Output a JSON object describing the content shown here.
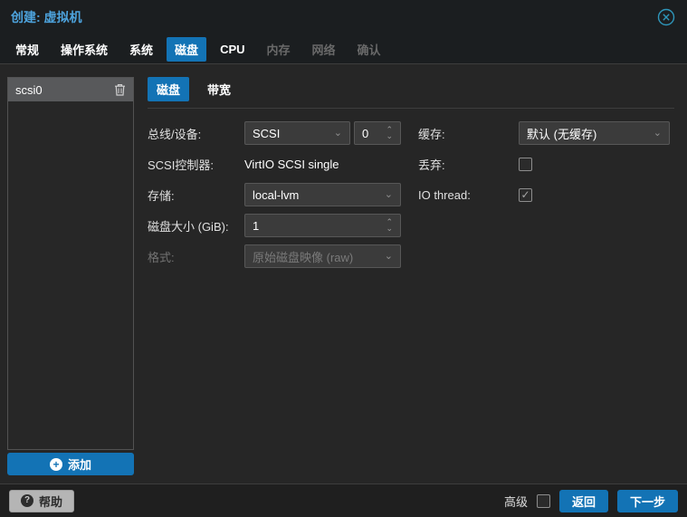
{
  "colors": {
    "accent": "#1373b5",
    "title_text": "#4da3dd",
    "close_icon": "#2e96ba"
  },
  "titlebar": {
    "title": "创建: 虚拟机"
  },
  "tabs": [
    {
      "label": "常规",
      "state": "normal"
    },
    {
      "label": "操作系统",
      "state": "normal"
    },
    {
      "label": "系统",
      "state": "normal"
    },
    {
      "label": "磁盘",
      "state": "active"
    },
    {
      "label": "CPU",
      "state": "normal"
    },
    {
      "label": "内存",
      "state": "disabled"
    },
    {
      "label": "网络",
      "state": "disabled"
    },
    {
      "label": "确认",
      "state": "disabled"
    }
  ],
  "sidebar": {
    "items": [
      {
        "label": "scsi0",
        "selected": true
      }
    ],
    "add_label": "添加"
  },
  "panel_tabs": [
    {
      "label": "磁盘",
      "state": "active"
    },
    {
      "label": "带宽",
      "state": "normal"
    }
  ],
  "form": {
    "left": [
      {
        "label": "总线/设备:",
        "type": "combo+number",
        "value": "SCSI",
        "number": "0"
      },
      {
        "label": "SCSI控制器:",
        "type": "text",
        "value": "VirtIO SCSI single"
      },
      {
        "label": "存储:",
        "type": "combo",
        "value": "local-lvm"
      },
      {
        "label": "磁盘大小 (GiB):",
        "type": "number",
        "value": "1"
      },
      {
        "label": "格式:",
        "type": "combo-disabled",
        "value": "原始磁盘映像 (raw)"
      }
    ],
    "right": [
      {
        "label": "缓存:",
        "type": "combo",
        "value": "默认 (无缓存)"
      },
      {
        "label": "丢弃:",
        "type": "checkbox",
        "checked": false,
        "check_glyph": ""
      },
      {
        "label": "IO thread:",
        "type": "checkbox",
        "checked": true,
        "check_glyph": "✓"
      }
    ]
  },
  "footer": {
    "help_label": "帮助",
    "advanced_label": "高级",
    "advanced_checked": false,
    "back_label": "返回",
    "next_label": "下一步"
  }
}
